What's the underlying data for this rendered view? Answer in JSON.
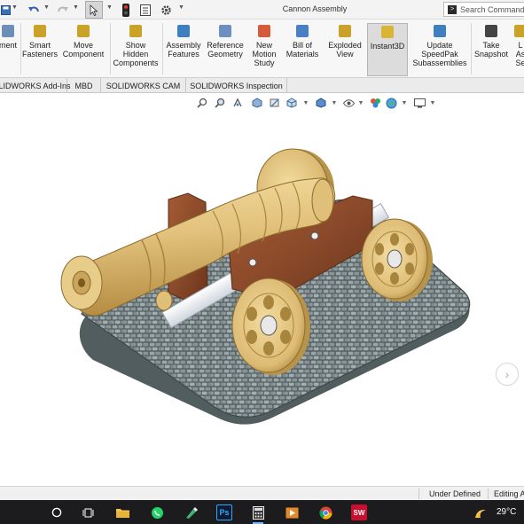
{
  "app": {
    "title": "Cannon Assembly",
    "search_placeholder": "Search Command"
  },
  "quick_access": [
    {
      "name": "save-icon"
    },
    {
      "name": "undo-icon"
    },
    {
      "name": "redo-icon"
    },
    {
      "name": "select-icon"
    },
    {
      "name": "traffic-light-icon"
    },
    {
      "name": "file-properties-icon"
    },
    {
      "name": "options-gear-icon"
    }
  ],
  "ribbon": {
    "buttons": [
      {
        "id": "ment",
        "label": "ment",
        "icon": "component-icon",
        "color": "#6b8fb8"
      },
      {
        "id": "smart-fasteners",
        "label": "Smart\nFasteners",
        "icon": "bolt-icon",
        "color": "#c9a227"
      },
      {
        "id": "move-component",
        "label": "Move\nComponent",
        "icon": "move-icon",
        "color": "#c9a227"
      },
      {
        "id": "show-hidden",
        "label": "Show\nHidden\nComponents",
        "icon": "eye-icon",
        "color": "#c9a227"
      },
      {
        "id": "assembly-features",
        "label": "Assembly\nFeatures",
        "icon": "assembly-feature-icon",
        "color": "#3f7fbf"
      },
      {
        "id": "reference-geometry",
        "label": "Reference\nGeometry",
        "icon": "plane-icon",
        "color": "#6d8fc2"
      },
      {
        "id": "new-motion-study",
        "label": "New\nMotion\nStudy",
        "icon": "motion-icon",
        "color": "#d65b3a"
      },
      {
        "id": "bill-of-materials",
        "label": "Bill of\nMaterials",
        "icon": "bom-icon",
        "color": "#4a7fc4"
      },
      {
        "id": "exploded-view",
        "label": "Exploded\nView",
        "icon": "explode-icon",
        "color": "#c9a227"
      },
      {
        "id": "instant3d",
        "label": "Instant3D",
        "icon": "instant3d-icon",
        "color": "#d9b437"
      },
      {
        "id": "update-speedpak",
        "label": "Update\nSpeedPak\nSubassemblies",
        "icon": "speedpak-icon",
        "color": "#3f7fbf"
      },
      {
        "id": "take-snapshot",
        "label": "Take\nSnapshot",
        "icon": "camera-icon",
        "color": "#444444"
      },
      {
        "id": "large-assembly",
        "label": "L\nAs\nSe",
        "icon": "large-assembly-icon",
        "color": "#c9a227"
      }
    ]
  },
  "tabs": [
    {
      "label": "OLIDWORKS Add-Ins"
    },
    {
      "label": "MBD"
    },
    {
      "label": "SOLIDWORKS CAM"
    },
    {
      "label": "SOLIDWORKS Inspection"
    }
  ],
  "heads_up_toolbar": [
    {
      "name": "zoom-to-fit-icon"
    },
    {
      "name": "zoom-to-area-icon"
    },
    {
      "name": "previous-view-icon"
    },
    {
      "name": "section-view-icon"
    },
    {
      "name": "dynamic-annotation-icon"
    },
    {
      "name": "view-orientation-icon"
    },
    {
      "name": "display-style-icon"
    },
    {
      "name": "hide-show-items-icon"
    },
    {
      "name": "edit-appearance-icon"
    },
    {
      "name": "apply-scene-icon"
    },
    {
      "name": "view-settings-icon"
    }
  ],
  "status": {
    "state": "Under Defined",
    "mode": "Editing A"
  },
  "taskbar": {
    "apps": [
      {
        "name": "start-circle-icon"
      },
      {
        "name": "task-view-icon"
      },
      {
        "name": "file-explorer-icon"
      },
      {
        "name": "whatsapp-icon"
      },
      {
        "name": "marker-app-icon"
      },
      {
        "name": "photoshop-icon",
        "label": "Ps"
      },
      {
        "name": "calculator-icon"
      },
      {
        "name": "media-player-icon"
      },
      {
        "name": "chrome-icon"
      },
      {
        "name": "solidworks-icon",
        "label": "SW"
      }
    ],
    "temperature": "29°C"
  },
  "colors": {
    "brass": "#e0c079",
    "brass_dark": "#b8944a",
    "wood": "#8b4a2a",
    "stone": "#7d8b8d"
  }
}
